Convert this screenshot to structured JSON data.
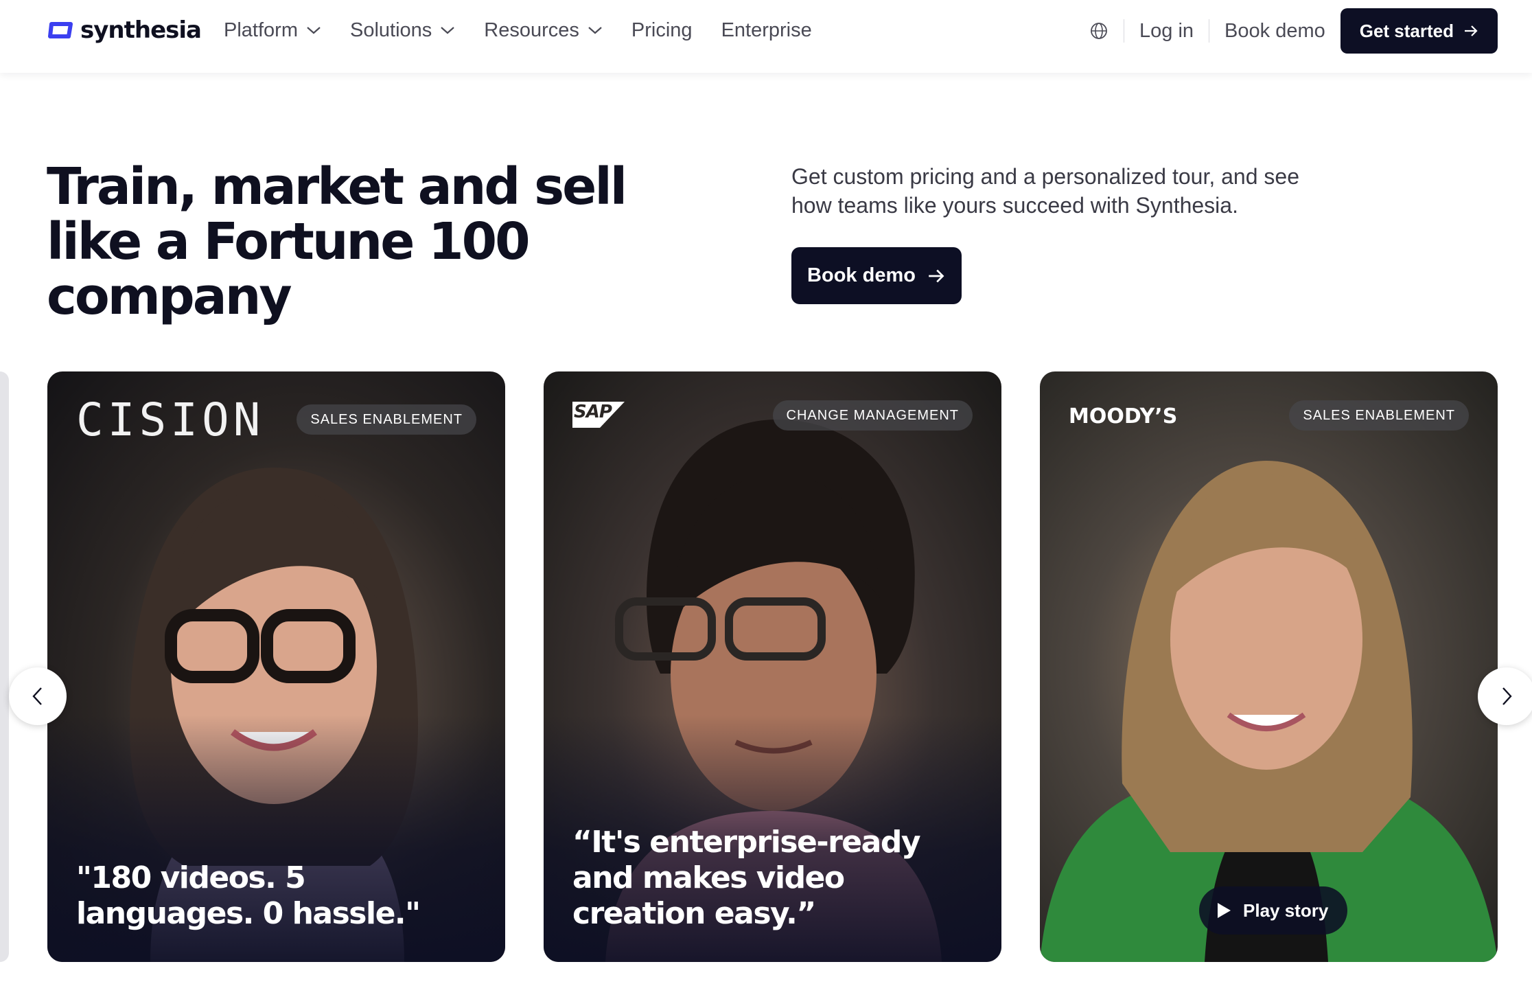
{
  "header": {
    "brand": "synthesia",
    "nav": [
      {
        "label": "Platform",
        "has_dropdown": true
      },
      {
        "label": "Solutions",
        "has_dropdown": true
      },
      {
        "label": "Resources",
        "has_dropdown": true
      },
      {
        "label": "Pricing",
        "has_dropdown": false
      },
      {
        "label": "Enterprise",
        "has_dropdown": false
      }
    ],
    "language_icon": "globe-icon",
    "login_label": "Log in",
    "book_demo_label": "Book demo",
    "get_started_label": "Get started"
  },
  "hero": {
    "title": "Train, market and sell like a Fortune 100 company",
    "subtitle": "Get custom pricing and a personalized tour, and see how teams like yours succeed with Synthesia.",
    "cta_label": "Book demo"
  },
  "cards": [
    {
      "company": "CISION",
      "tag": "SALES ENABLEMENT",
      "quote": "\"180 videos. 5 languages. 0 hassle.\""
    },
    {
      "company": "SAP",
      "tag": "CHANGE MANAGEMENT",
      "quote": "“It's enterprise-ready and makes video creation easy.”"
    },
    {
      "company": "MOODY’S",
      "tag": "SALES ENABLEMENT",
      "play_label": "Play story"
    }
  ],
  "colors": {
    "brand_dark": "#0d0f24",
    "logo_accent": "#3b3ff0",
    "nav_text": "#4a4a55"
  }
}
